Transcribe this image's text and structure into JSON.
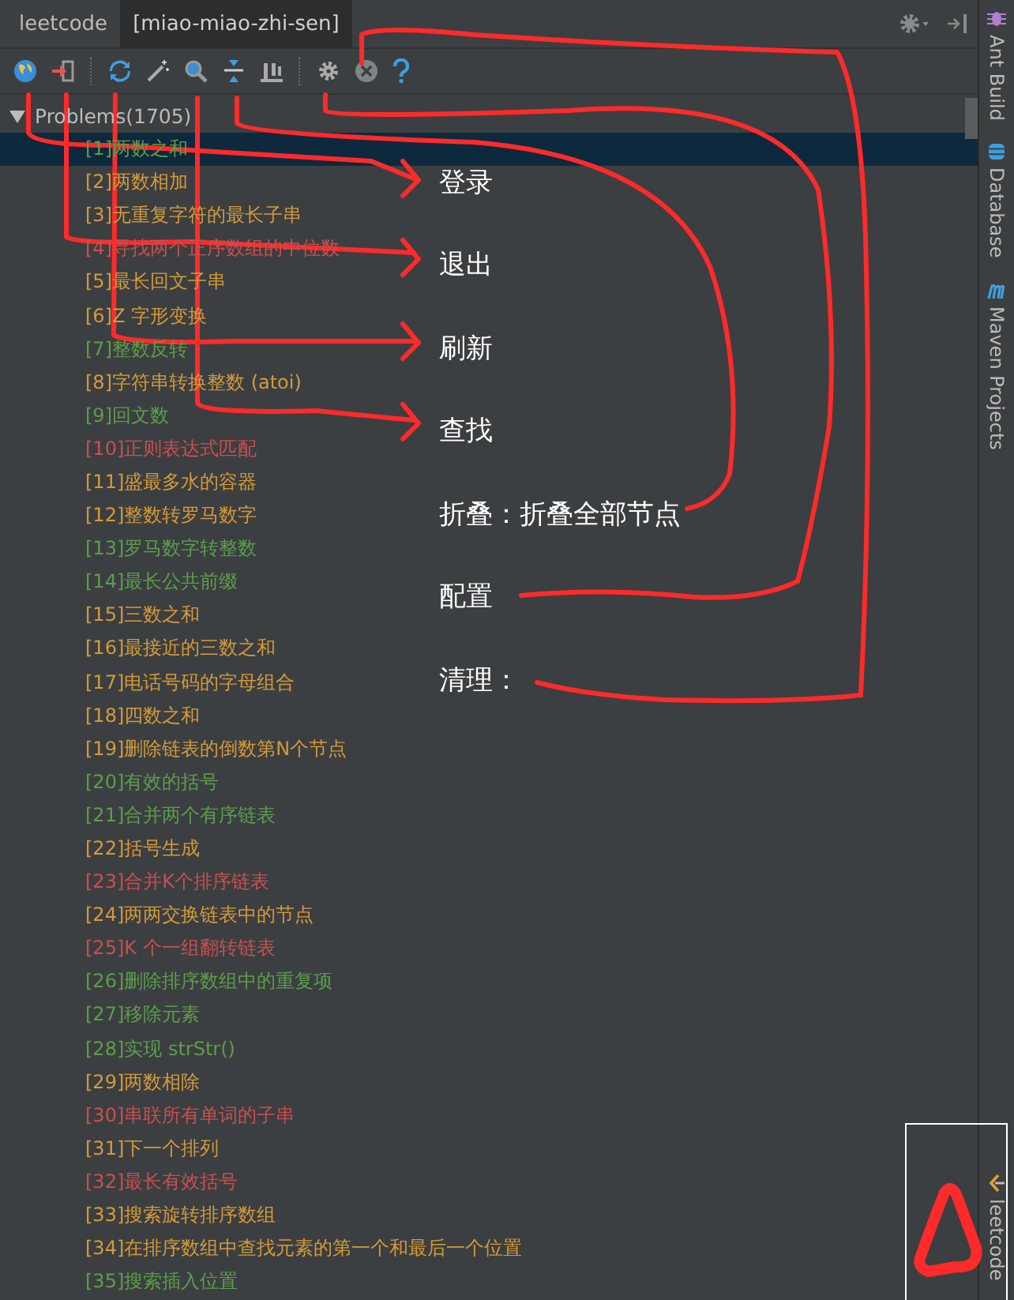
{
  "tabs": [
    {
      "label": "leetcode",
      "selected": false
    },
    {
      "label": "[miao-miao-zhi-sen]",
      "selected": true
    }
  ],
  "toolbar": [
    {
      "kind": "globe"
    },
    {
      "kind": "exit"
    },
    {
      "kind": "separator"
    },
    {
      "kind": "refresh"
    },
    {
      "kind": "wand"
    },
    {
      "kind": "search"
    },
    {
      "kind": "collapse"
    },
    {
      "kind": "chart"
    },
    {
      "kind": "separator"
    },
    {
      "kind": "gear"
    },
    {
      "kind": "clear"
    },
    {
      "kind": "help"
    }
  ],
  "tree": {
    "label": "Problems(1705)",
    "expanded": true,
    "children": [
      {
        "label": "[1]两数之和",
        "color": "#5b9e4a",
        "selected": true
      },
      {
        "label": "[2]两数相加",
        "color": "#d49a3a",
        "selected": false
      },
      {
        "label": "[3]无重复字符的最长子串",
        "color": "#d49a3a",
        "selected": false
      },
      {
        "label": "[4]寻找两个正序数组的中位数",
        "color": "#c94f4f",
        "selected": false
      },
      {
        "label": "[5]最长回文子串",
        "color": "#d49a3a",
        "selected": false
      },
      {
        "label": "[6]Z 字形变换",
        "color": "#d49a3a",
        "selected": false
      },
      {
        "label": "[7]整数反转",
        "color": "#5b9e4a",
        "selected": false
      },
      {
        "label": "[8]字符串转换整数 (atoi)",
        "color": "#d49a3a",
        "selected": false
      },
      {
        "label": "[9]回文数",
        "color": "#5b9e4a",
        "selected": false
      },
      {
        "label": "[10]正则表达式匹配",
        "color": "#c94f4f",
        "selected": false
      },
      {
        "label": "[11]盛最多水的容器",
        "color": "#d49a3a",
        "selected": false
      },
      {
        "label": "[12]整数转罗马数字",
        "color": "#d49a3a",
        "selected": false
      },
      {
        "label": "[13]罗马数字转整数",
        "color": "#5b9e4a",
        "selected": false
      },
      {
        "label": "[14]最长公共前缀",
        "color": "#5b9e4a",
        "selected": false
      },
      {
        "label": "[15]三数之和",
        "color": "#d49a3a",
        "selected": false
      },
      {
        "label": "[16]最接近的三数之和",
        "color": "#d49a3a",
        "selected": false
      },
      {
        "label": "[17]电话号码的字母组合",
        "color": "#d49a3a",
        "selected": false
      },
      {
        "label": "[18]四数之和",
        "color": "#d49a3a",
        "selected": false
      },
      {
        "label": "[19]删除链表的倒数第N个节点",
        "color": "#d49a3a",
        "selected": false
      },
      {
        "label": "[20]有效的括号",
        "color": "#5b9e4a",
        "selected": false
      },
      {
        "label": "[21]合并两个有序链表",
        "color": "#5b9e4a",
        "selected": false
      },
      {
        "label": "[22]括号生成",
        "color": "#d49a3a",
        "selected": false
      },
      {
        "label": "[23]合并K个排序链表",
        "color": "#c94f4f",
        "selected": false
      },
      {
        "label": "[24]两两交换链表中的节点",
        "color": "#d49a3a",
        "selected": false
      },
      {
        "label": "[25]K 个一组翻转链表",
        "color": "#c94f4f",
        "selected": false
      },
      {
        "label": "[26]删除排序数组中的重复项",
        "color": "#5b9e4a",
        "selected": false
      },
      {
        "label": "[27]移除元素",
        "color": "#5b9e4a",
        "selected": false
      },
      {
        "label": "[28]实现 strStr()",
        "color": "#5b9e4a",
        "selected": false
      },
      {
        "label": "[29]两数相除",
        "color": "#d49a3a",
        "selected": false
      },
      {
        "label": "[30]串联所有单词的子串",
        "color": "#c94f4f",
        "selected": false
      },
      {
        "label": "[31]下一个排列",
        "color": "#d49a3a",
        "selected": false
      },
      {
        "label": "[32]最长有效括号",
        "color": "#c94f4f",
        "selected": false
      },
      {
        "label": "[33]搜索旋转排序数组",
        "color": "#d49a3a",
        "selected": false
      },
      {
        "label": "[34]在排序数组中查找元素的第一个和最后一个位置",
        "color": "#d49a3a",
        "selected": false
      },
      {
        "label": "[35]搜索插入位置",
        "color": "#5b9e4a",
        "selected": false
      }
    ]
  },
  "annotations": [
    "登录",
    "退出",
    "刷新",
    "查找",
    "折叠：折叠全部节点",
    "配置",
    "清理："
  ],
  "side_tools": [
    {
      "kind": "ant",
      "label": "Ant Build"
    },
    {
      "kind": "database",
      "label": "Database"
    },
    {
      "kind": "maven",
      "label": "Maven Projects"
    }
  ],
  "bottom_tool": {
    "kind": "leetcode",
    "label": "leetcode"
  }
}
